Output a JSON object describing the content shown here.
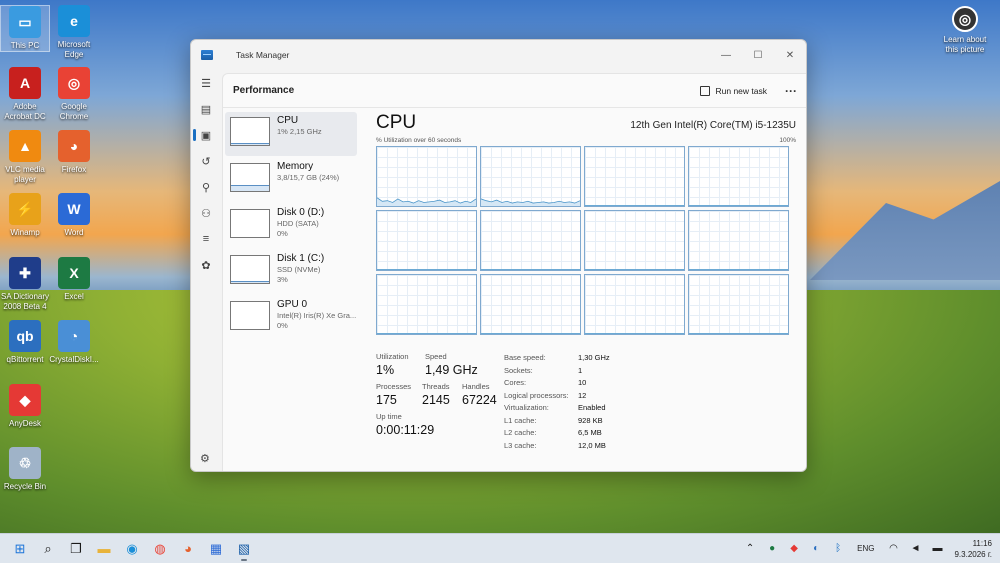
{
  "desktop": {
    "icons": [
      {
        "label": "This PC",
        "icon": "monitor-icon",
        "color": "#3a9be0"
      },
      {
        "label": "Microsoft Edge",
        "icon": "edge-icon",
        "color": "#1b8fd8"
      },
      {
        "label": "Adobe Acrobat DC",
        "icon": "acrobat-icon",
        "color": "#c8201e"
      },
      {
        "label": "Google Chrome",
        "icon": "chrome-icon",
        "color": "#e94235"
      },
      {
        "label": "VLC media player",
        "icon": "vlc-icon",
        "color": "#f08a10"
      },
      {
        "label": "Firefox",
        "icon": "firefox-icon",
        "color": "#e5612d"
      },
      {
        "label": "Winamp",
        "icon": "winamp-icon",
        "color": "#e8a21a"
      },
      {
        "label": "Word",
        "icon": "word-icon",
        "color": "#2b6ad6"
      },
      {
        "label": "SA Dictionary 2008 Beta 4",
        "icon": "uk-flag-icon",
        "color": "#1f3d8a"
      },
      {
        "label": "Excel",
        "icon": "excel-icon",
        "color": "#1d7a43"
      },
      {
        "label": "qBittorrent",
        "icon": "qbittorrent-icon",
        "color": "#2c6fbf"
      },
      {
        "label": "CrystalDiskI...",
        "icon": "crystaldisk-icon",
        "color": "#4a8fd6"
      },
      {
        "label": "AnyDesk",
        "icon": "anydesk-icon",
        "color": "#e53935"
      },
      {
        "label": "Recycle Bin",
        "icon": "recycle-bin-icon",
        "color": "#9fb3c8"
      }
    ],
    "learn_about": "Learn about this picture"
  },
  "window": {
    "title": "Task Manager",
    "section_title": "Performance",
    "run_task_label": "Run new task"
  },
  "resources": [
    {
      "name": "CPU",
      "sub1": "1% 2,15 GHz",
      "sub2": "",
      "fill": 0.01
    },
    {
      "name": "Memory",
      "sub1": "3,8/15,7 GB (24%)",
      "sub2": "",
      "fill": 0.24
    },
    {
      "name": "Disk 0 (D:)",
      "sub1": "HDD (SATA)",
      "sub2": "0%",
      "fill": 0
    },
    {
      "name": "Disk 1 (C:)",
      "sub1": "SSD (NVMe)",
      "sub2": "3%",
      "fill": 0.03
    },
    {
      "name": "GPU 0",
      "sub1": "Intel(R) Iris(R) Xe Gra...",
      "sub2": "0%",
      "fill": 0
    }
  ],
  "cpu": {
    "title": "CPU",
    "model": "12th Gen Intel(R) Core(TM) i5-1235U",
    "axis_left": "% Utilization over 60 seconds",
    "axis_right": "100%",
    "utilization_label": "Utilization",
    "utilization": "1%",
    "speed_label": "Speed",
    "speed": "1,49 GHz",
    "processes_label": "Processes",
    "processes": "175",
    "threads_label": "Threads",
    "threads": "2145",
    "handles_label": "Handles",
    "handles": "67224",
    "uptime_label": "Up time",
    "uptime": "0:00:11:29",
    "specs": [
      {
        "k": "Base speed:",
        "v": "1,30 GHz"
      },
      {
        "k": "Sockets:",
        "v": "1"
      },
      {
        "k": "Cores:",
        "v": "10"
      },
      {
        "k": "Logical processors:",
        "v": "12"
      },
      {
        "k": "Virtualization:",
        "v": "Enabled"
      },
      {
        "k": "L1 cache:",
        "v": "928 KB"
      },
      {
        "k": "L2 cache:",
        "v": "6,5 MB"
      },
      {
        "k": "L3 cache:",
        "v": "12,0 MB"
      }
    ],
    "core_utilization": [
      [
        14,
        8,
        9,
        6,
        12,
        7,
        8,
        5,
        9,
        6,
        7,
        8,
        10,
        6,
        7,
        9,
        5,
        8,
        6,
        12
      ],
      [
        12,
        9,
        7,
        10,
        6,
        8,
        5,
        7,
        6,
        8,
        5,
        6,
        7,
        5,
        6,
        8,
        6,
        7,
        5,
        9
      ],
      [
        1,
        1,
        1,
        1,
        1,
        1,
        1,
        1,
        1,
        1,
        1,
        1,
        1,
        1,
        1,
        1,
        1,
        1,
        1,
        1
      ],
      [
        1,
        1,
        1,
        1,
        1,
        1,
        1,
        1,
        1,
        1,
        1,
        1,
        1,
        1,
        1,
        1,
        1,
        1,
        1,
        1
      ],
      [
        1,
        1,
        1,
        1,
        1,
        1,
        1,
        1,
        1,
        1,
        1,
        1,
        1,
        1,
        1,
        1,
        1,
        1,
        1,
        1
      ],
      [
        1,
        1,
        1,
        1,
        1,
        1,
        1,
        1,
        1,
        1,
        1,
        1,
        1,
        1,
        1,
        1,
        1,
        1,
        1,
        1
      ],
      [
        1,
        1,
        1,
        1,
        1,
        1,
        1,
        1,
        1,
        1,
        1,
        1,
        1,
        1,
        1,
        1,
        1,
        1,
        1,
        1
      ],
      [
        1,
        1,
        1,
        1,
        1,
        1,
        1,
        1,
        1,
        1,
        1,
        1,
        1,
        1,
        1,
        1,
        1,
        1,
        1,
        1
      ],
      [
        1,
        1,
        1,
        1,
        1,
        1,
        1,
        1,
        1,
        1,
        1,
        1,
        1,
        1,
        1,
        1,
        1,
        1,
        1,
        1
      ],
      [
        1,
        1,
        1,
        1,
        1,
        1,
        1,
        1,
        1,
        1,
        1,
        1,
        1,
        1,
        1,
        1,
        1,
        1,
        1,
        1
      ],
      [
        1,
        1,
        1,
        1,
        1,
        1,
        1,
        1,
        1,
        1,
        1,
        1,
        1,
        1,
        1,
        1,
        1,
        1,
        1,
        1
      ],
      [
        1,
        1,
        1,
        1,
        1,
        1,
        1,
        1,
        1,
        1,
        1,
        1,
        1,
        1,
        1,
        1,
        1,
        1,
        1,
        1
      ]
    ]
  },
  "taskbar": {
    "language": "ENG",
    "time": "11:16",
    "date": "9.3.2026 г."
  },
  "colors": {
    "accent": "#1a6fc2",
    "graph_line": "#4a95c9"
  }
}
